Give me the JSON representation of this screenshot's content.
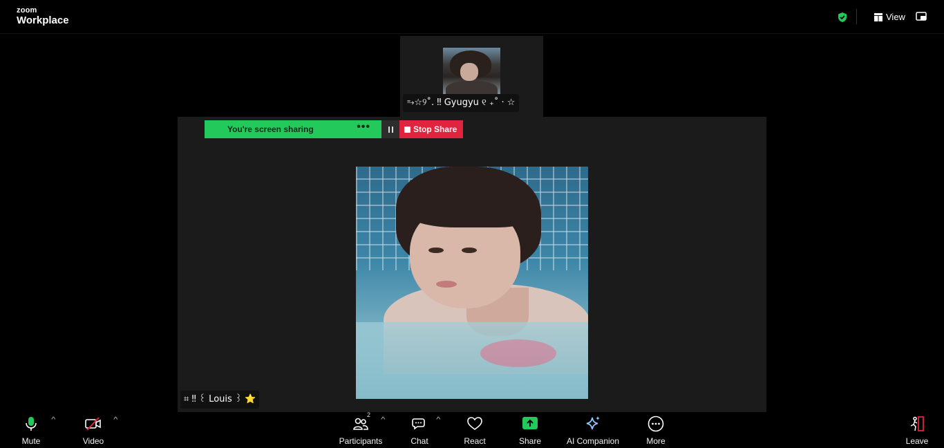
{
  "topbar": {
    "brand_small": "zoom",
    "brand_large": "Workplace",
    "view_label": "View"
  },
  "thumbnail": {
    "participant_name": "⥱☆୨˚. ‼ Gyugyu ୧ ₊˚ · ☆"
  },
  "share_controls": {
    "status_label": "You're screen sharing",
    "more_label": "•••",
    "stop_label": "Stop Share"
  },
  "self_view": {
    "participant_name": "⌗ ‼ ꒰ Louis ꒱ ⭐"
  },
  "toolbar": {
    "mute_label": "Mute",
    "video_label": "Video",
    "participants_label": "Participants",
    "participants_count": "2",
    "chat_label": "Chat",
    "react_label": "React",
    "share_label": "Share",
    "ai_label": "AI Companion",
    "more_label": "More",
    "leave_label": "Leave",
    "caret": "^"
  },
  "colors": {
    "share_green": "#23c95b",
    "stop_red": "#e0243d",
    "mic_green": "#23c95b",
    "video_off_red": "#e0243d",
    "shield_green": "#23c95b"
  }
}
